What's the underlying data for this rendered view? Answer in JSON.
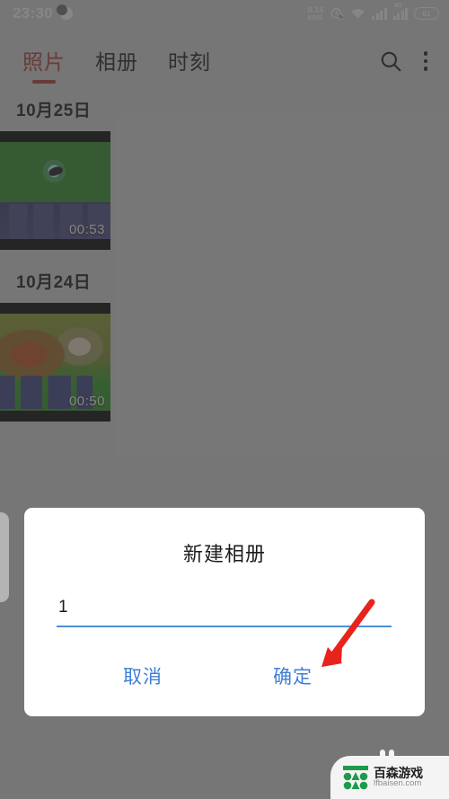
{
  "status_bar": {
    "time": "23:30",
    "moon_icon": "moon-icon",
    "net_speed_value": "0.14",
    "net_speed_unit": "KB/S",
    "alarm_icon": "alarm-off-icon",
    "wifi_icon": "wifi-icon",
    "signal_icon": "signal-bars-icon",
    "signal_4g_label": "4G",
    "battery_level": "61"
  },
  "app_bar": {
    "tabs": [
      {
        "label": "照片",
        "active": true
      },
      {
        "label": "相册",
        "active": false
      },
      {
        "label": "时刻",
        "active": false
      }
    ],
    "search_icon": "search-icon",
    "overflow_icon": "overflow-menu-icon",
    "active_color": "#b03a34"
  },
  "gallery": {
    "sections": [
      {
        "date": "10月25日",
        "items": [
          {
            "duration": "00:53",
            "type": "video"
          }
        ]
      },
      {
        "date": "10月24日",
        "items": [
          {
            "duration": "00:50",
            "type": "video"
          }
        ]
      }
    ]
  },
  "dialog": {
    "title": "新建相册",
    "input_value": "1",
    "input_placeholder": "",
    "cancel_label": "取消",
    "confirm_label": "确定",
    "accent_color": "#3f7fd4"
  },
  "annotation": {
    "arrow_icon": "red-arrow-icon",
    "arrow_color": "#e8231c",
    "points_at": "确定"
  },
  "watermark": {
    "name": "百森游戏",
    "url": "lfbaisen.com",
    "logo_icon": "baisen-logo-icon",
    "logo_color": "#1f9a4d"
  }
}
